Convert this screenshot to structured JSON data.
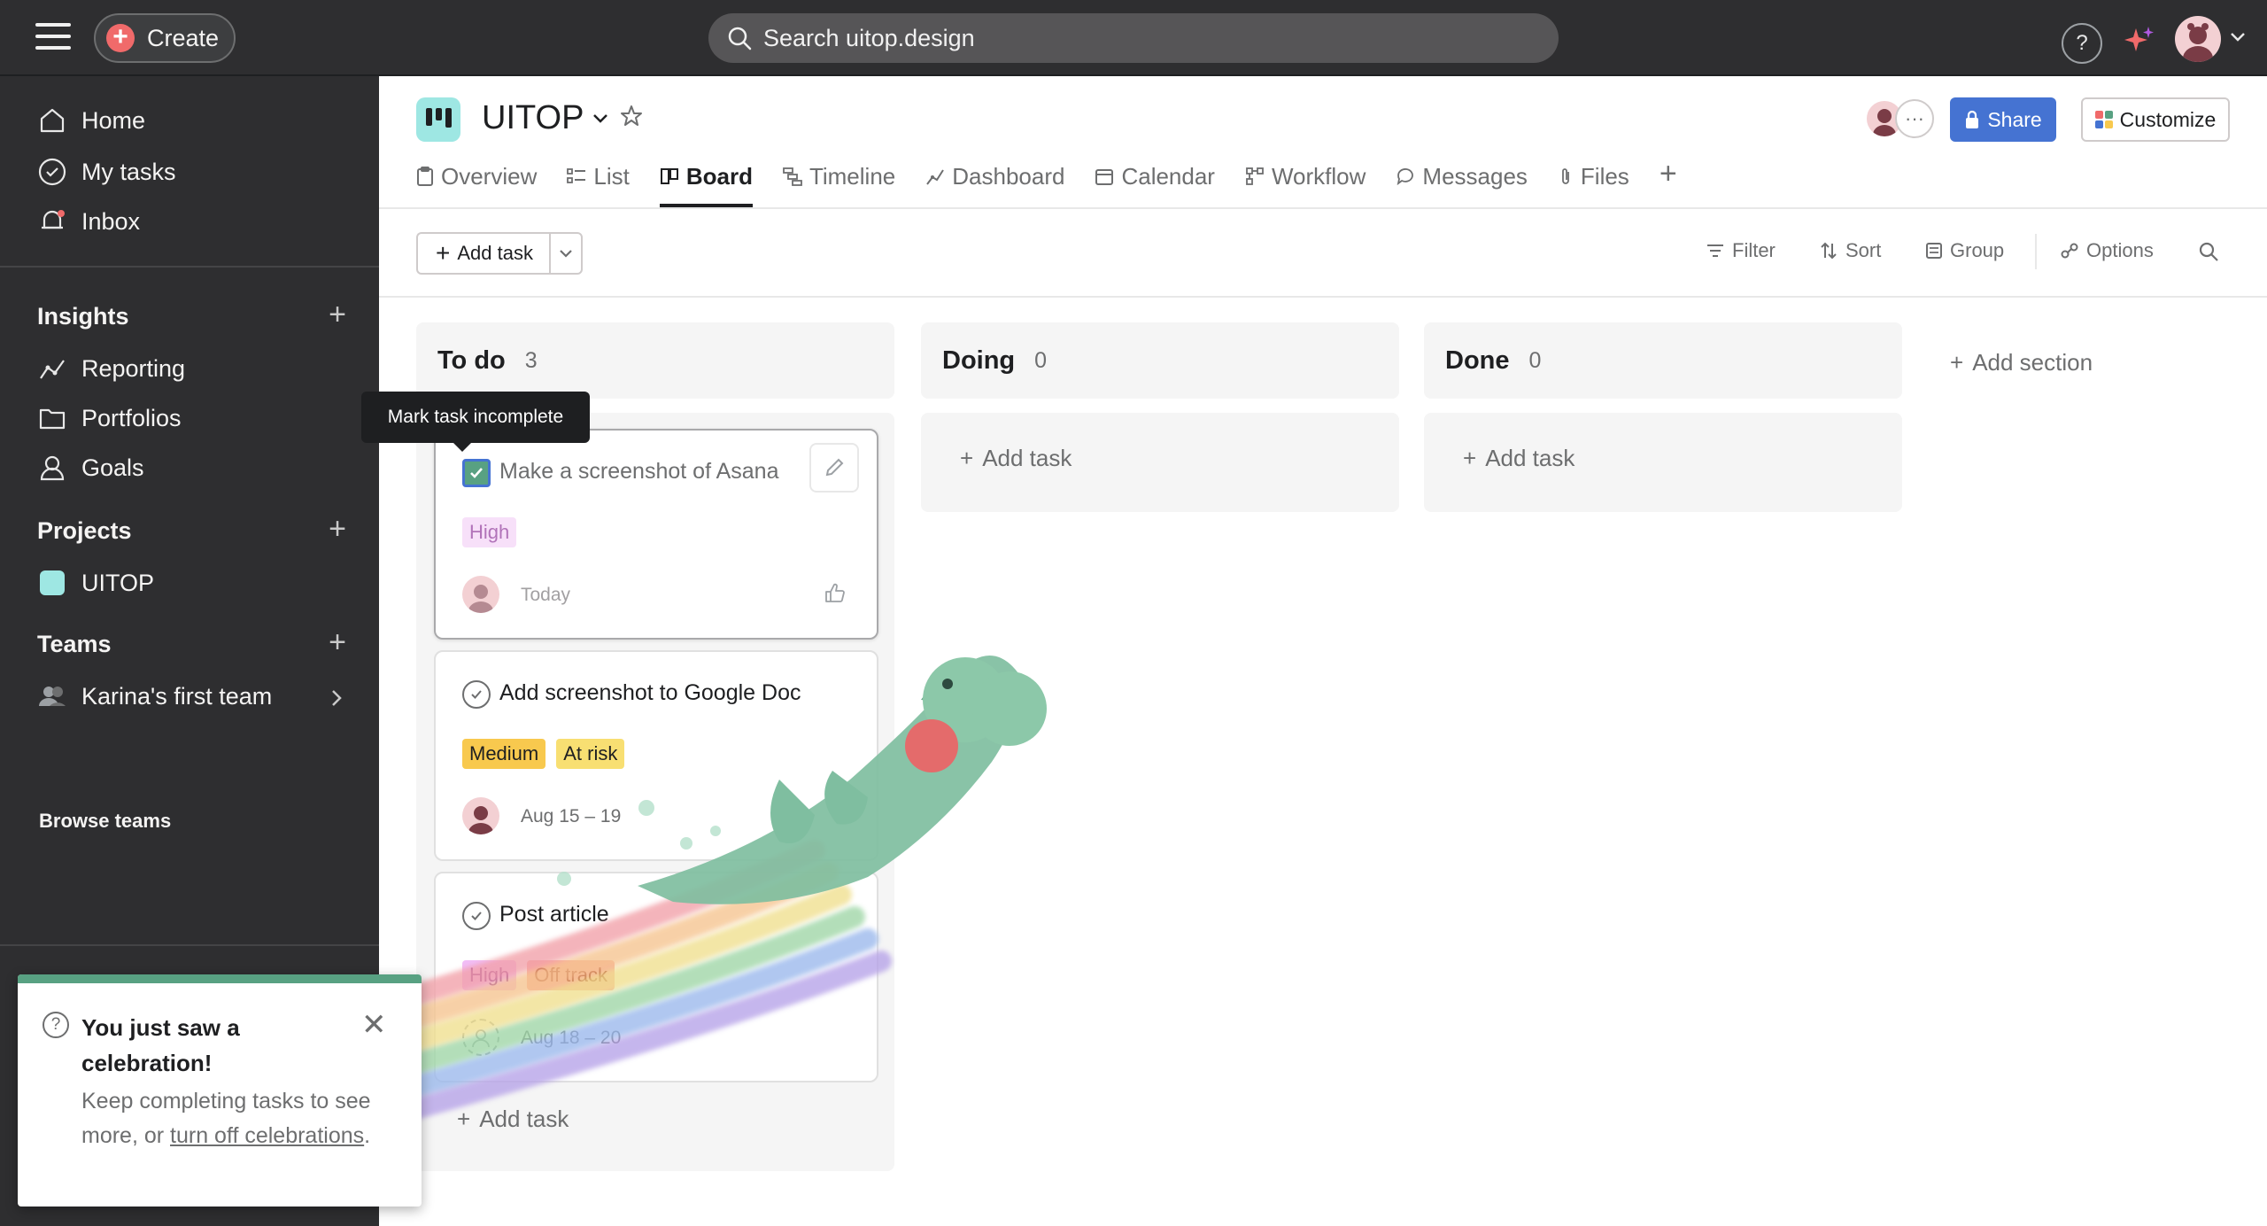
{
  "topbar": {
    "create_label": "Create",
    "search_placeholder": "Search uitop.design",
    "help_label": "?"
  },
  "sidebar": {
    "nav": [
      {
        "label": "Home",
        "icon": "home-icon"
      },
      {
        "label": "My tasks",
        "icon": "check-circle-icon"
      },
      {
        "label": "Inbox",
        "icon": "bell-icon"
      }
    ],
    "insights": {
      "title": "Insights",
      "items": [
        {
          "label": "Reporting",
          "icon": "chart-line-icon"
        },
        {
          "label": "Portfolios",
          "icon": "folder-icon"
        },
        {
          "label": "Goals",
          "icon": "person-icon"
        }
      ]
    },
    "projects": {
      "title": "Projects",
      "items": [
        {
          "label": "UITOP",
          "color": "#9ee7e3"
        }
      ]
    },
    "teams": {
      "title": "Teams",
      "items": [
        {
          "label": "Karina's first team",
          "icon": "team-icon"
        }
      ],
      "browse": "Browse teams"
    }
  },
  "celebration": {
    "title": "You just saw a celebration!",
    "body_prefix": "Keep completing tasks to see more, or ",
    "link": "turn off celebrations",
    "body_suffix": "."
  },
  "project": {
    "title": "UITOP",
    "share_label": "Share",
    "customize_label": "Customize",
    "tabs": [
      {
        "label": "Overview",
        "icon": "clipboard-icon"
      },
      {
        "label": "List",
        "icon": "list-icon"
      },
      {
        "label": "Board",
        "icon": "board-icon",
        "active": true
      },
      {
        "label": "Timeline",
        "icon": "timeline-icon"
      },
      {
        "label": "Dashboard",
        "icon": "dashboard-icon"
      },
      {
        "label": "Calendar",
        "icon": "calendar-icon"
      },
      {
        "label": "Workflow",
        "icon": "workflow-icon"
      },
      {
        "label": "Messages",
        "icon": "message-icon"
      },
      {
        "label": "Files",
        "icon": "paperclip-icon"
      }
    ]
  },
  "toolbar": {
    "add_task": "Add task",
    "filter": "Filter",
    "sort": "Sort",
    "group": "Group",
    "options": "Options"
  },
  "board": {
    "columns": [
      {
        "title": "To do",
        "count": "3",
        "add_label": "Add task"
      },
      {
        "title": "Doing",
        "count": "0",
        "add_label": "Add task"
      },
      {
        "title": "Done",
        "count": "0",
        "add_label": "Add task"
      }
    ],
    "add_section": "Add section",
    "cards": [
      {
        "title": "Make a screenshot of Asana",
        "completed": true,
        "tags": [
          "High"
        ],
        "date": "Today"
      },
      {
        "title": "Add screenshot to Google Doc",
        "completed": false,
        "tags": [
          "Medium",
          "At risk"
        ],
        "date": "Aug 15 – 19"
      },
      {
        "title": "Post article",
        "completed": false,
        "tags": [
          "High",
          "Off track"
        ],
        "date": "Aug 18 – 20"
      }
    ],
    "tooltip": "Mark task incomplete"
  },
  "colors": {
    "topbar_bg": "#2e2e30",
    "accent_blue": "#4573d2",
    "create_red": "#f06a6a",
    "success_green": "#58a182",
    "project_teal": "#9ee7e3"
  }
}
